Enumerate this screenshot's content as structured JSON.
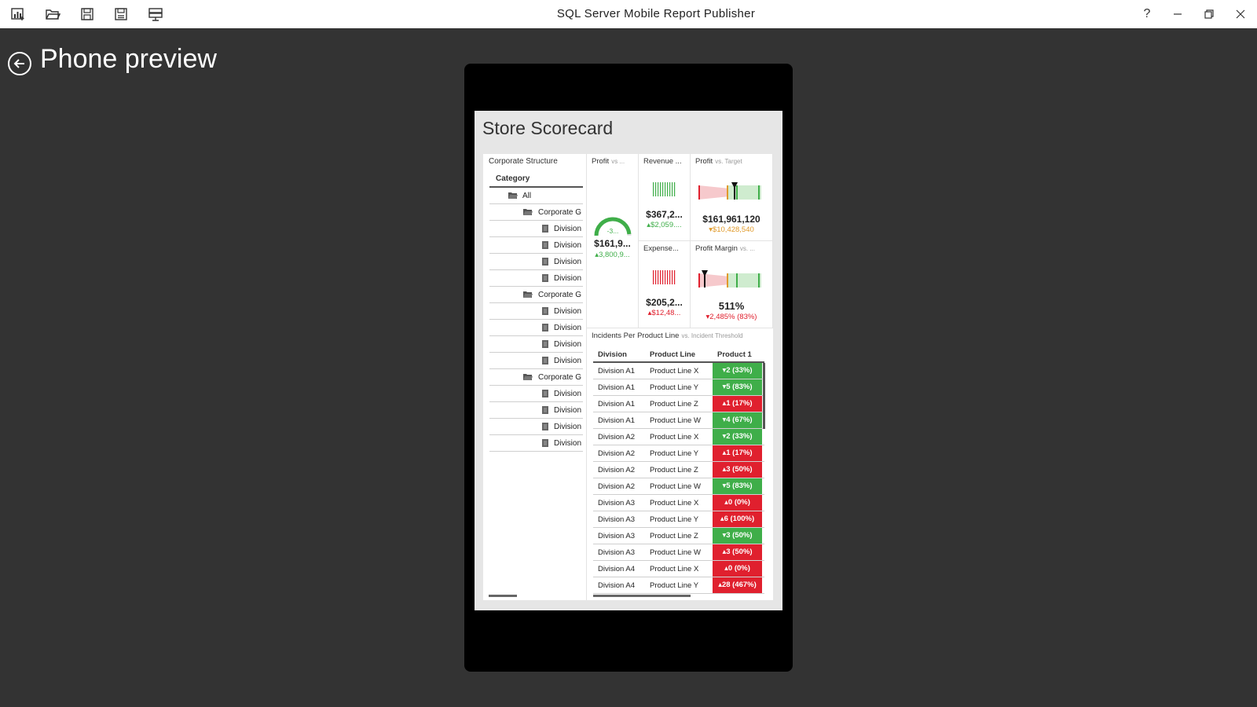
{
  "app": {
    "title": "SQL Server Mobile Report Publisher"
  },
  "toolbar": [
    "new-report-icon",
    "open-icon",
    "save-icon",
    "save-as-icon",
    "publish-icon"
  ],
  "window_controls": {
    "help": "?"
  },
  "page": {
    "title": "Phone preview"
  },
  "report": {
    "title": "Store Scorecard",
    "navigator": {
      "title": "Corporate Structure",
      "header": "Category",
      "items": [
        {
          "level": 0,
          "label": "All",
          "icon": "folder-icon"
        },
        {
          "level": 1,
          "label": "Corporate G",
          "icon": "folder-icon"
        },
        {
          "level": 2,
          "label": "Division",
          "icon": "document-icon"
        },
        {
          "level": 2,
          "label": "Division",
          "icon": "document-icon"
        },
        {
          "level": 2,
          "label": "Division",
          "icon": "document-icon"
        },
        {
          "level": 2,
          "label": "Division",
          "icon": "document-icon"
        },
        {
          "level": 1,
          "label": "Corporate G",
          "icon": "folder-icon"
        },
        {
          "level": 2,
          "label": "Division",
          "icon": "document-icon"
        },
        {
          "level": 2,
          "label": "Division",
          "icon": "document-icon"
        },
        {
          "level": 2,
          "label": "Division",
          "icon": "document-icon"
        },
        {
          "level": 2,
          "label": "Division",
          "icon": "document-icon"
        },
        {
          "level": 1,
          "label": "Corporate G",
          "icon": "folder-icon"
        },
        {
          "level": 2,
          "label": "Division",
          "icon": "document-icon"
        },
        {
          "level": 2,
          "label": "Division",
          "icon": "document-icon"
        },
        {
          "level": 2,
          "label": "Division",
          "icon": "document-icon"
        },
        {
          "level": 2,
          "label": "Division",
          "icon": "document-icon"
        }
      ]
    },
    "tiles": {
      "profit_gauge": {
        "title": "Profit",
        "sub": "vs ...",
        "gauge_label": "-3...",
        "value": "$161,9...",
        "delta": "▴3,800,9...",
        "level": 0.97
      },
      "revenue": {
        "title": "Revenue ...",
        "value": "$367,2...",
        "delta": "▴$2,059...."
      },
      "profit_bullet": {
        "title": "Profit",
        "sub": "vs. Target",
        "value": "$161,961,120",
        "delta": "▾$10,428,540"
      },
      "expense": {
        "title": "Expense...",
        "value": "$205,2...",
        "delta": "▴$12,48..."
      },
      "profit_margin": {
        "title": "Profit Margin",
        "sub": "vs. ...",
        "value": "511%",
        "delta": "▾2,485% (83%)"
      }
    },
    "grid": {
      "title": "Incidents Per Product Line",
      "sub": "vs. Incident Threshold",
      "columns": [
        "Division",
        "Product Line",
        "Product 1"
      ],
      "rows": [
        {
          "division": "Division A1",
          "line": "Product Line X",
          "value": "▾2 (33%)",
          "status": "good"
        },
        {
          "division": "Division A1",
          "line": "Product Line Y",
          "value": "▾5 (83%)",
          "status": "good"
        },
        {
          "division": "Division A1",
          "line": "Product Line Z",
          "value": "▴1 (17%)",
          "status": "bad"
        },
        {
          "division": "Division A1",
          "line": "Product Line W",
          "value": "▾4 (67%)",
          "status": "good"
        },
        {
          "division": "Division A2",
          "line": "Product Line X",
          "value": "▾2 (33%)",
          "status": "good"
        },
        {
          "division": "Division A2",
          "line": "Product Line Y",
          "value": "▴1 (17%)",
          "status": "bad"
        },
        {
          "division": "Division A2",
          "line": "Product Line Z",
          "value": "▴3 (50%)",
          "status": "bad"
        },
        {
          "division": "Division A2",
          "line": "Product Line W",
          "value": "▾5 (83%)",
          "status": "good"
        },
        {
          "division": "Division A3",
          "line": "Product Line X",
          "value": "▴0 (0%)",
          "status": "bad"
        },
        {
          "division": "Division A3",
          "line": "Product Line Y",
          "value": "▴6 (100%)",
          "status": "bad"
        },
        {
          "division": "Division A3",
          "line": "Product Line Z",
          "value": "▾3 (50%)",
          "status": "good"
        },
        {
          "division": "Division A3",
          "line": "Product Line W",
          "value": "▴3 (50%)",
          "status": "bad"
        },
        {
          "division": "Division A4",
          "line": "Product Line X",
          "value": "▴0 (0%)",
          "status": "bad"
        },
        {
          "division": "Division A4",
          "line": "Product Line Y",
          "value": "▴28 (467%)",
          "status": "bad"
        }
      ]
    }
  },
  "colors": {
    "good": "#3fae49",
    "bad": "#e0202e",
    "background": "#333333",
    "phone": "#000000"
  }
}
